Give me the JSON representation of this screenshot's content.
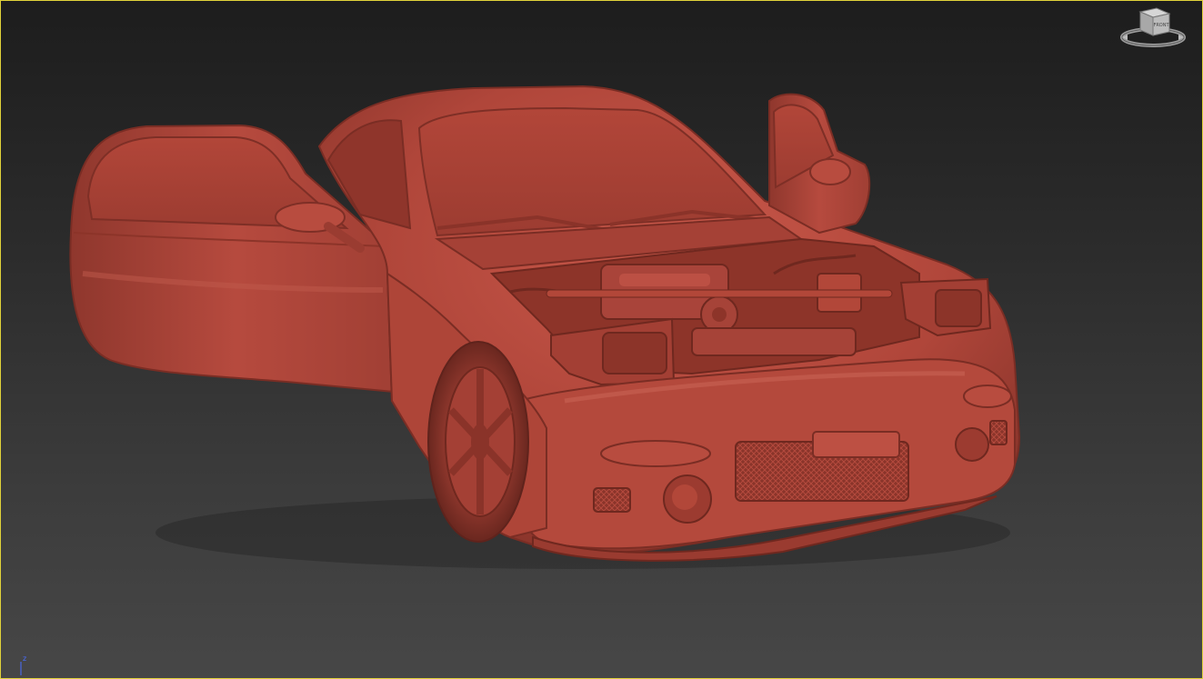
{
  "viewport": {
    "border_color": "#e1d33a",
    "shading": "clay"
  },
  "model": {
    "color": "#b0463a"
  },
  "viewcube": {
    "face_label": "FRONT",
    "icon": "viewcube-icon"
  },
  "axis_tripod": {
    "z_label": "z",
    "icon": "axis-tripod-icon"
  }
}
